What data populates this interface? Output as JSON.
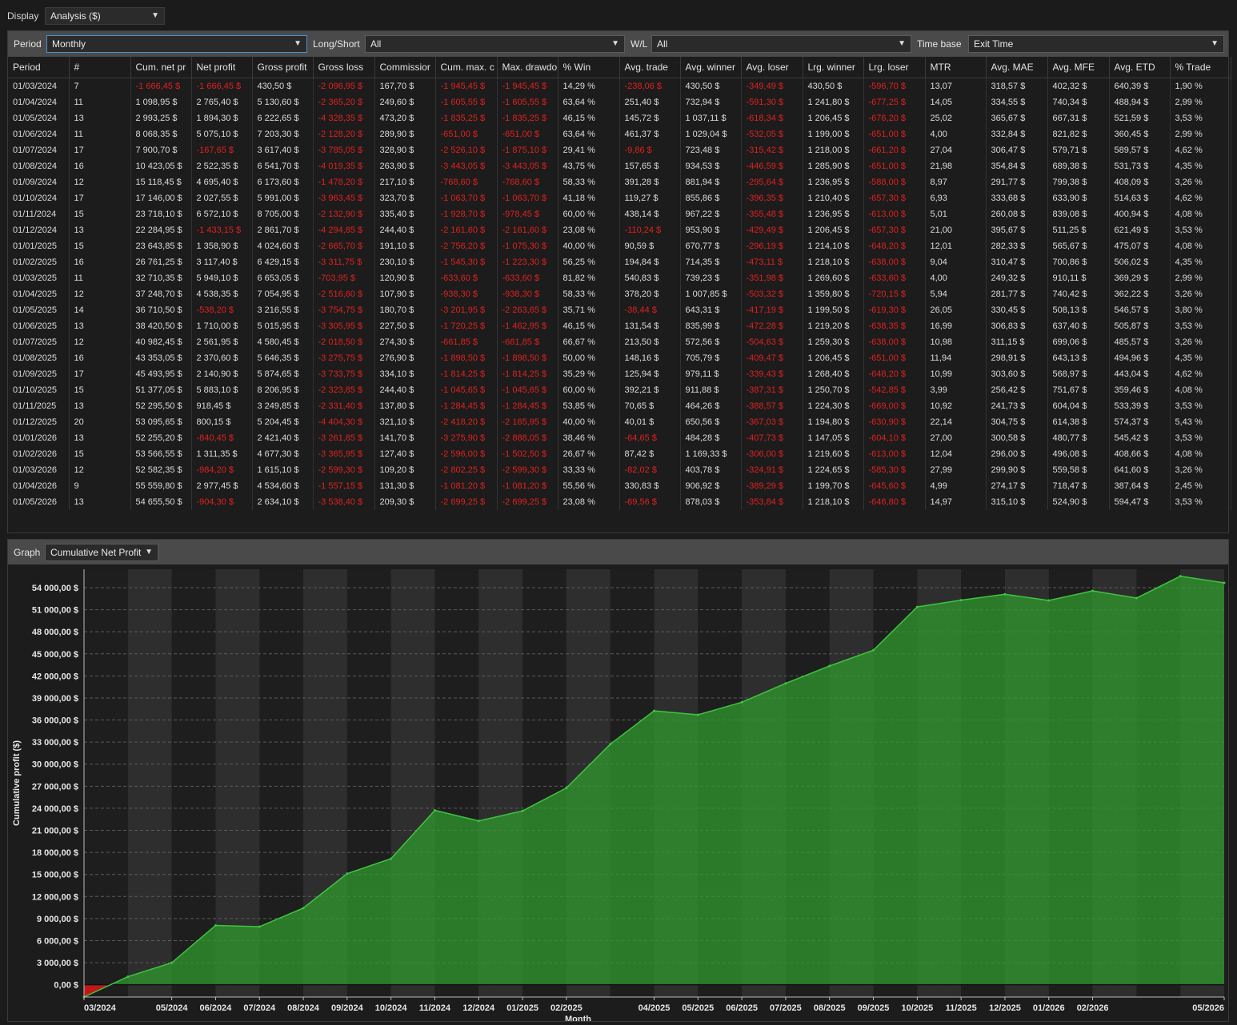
{
  "display": {
    "label": "Display",
    "value": "Analysis ($)"
  },
  "filters": {
    "period": {
      "label": "Period",
      "value": "Monthly"
    },
    "long_short": {
      "label": "Long/Short",
      "value": "All"
    },
    "wl": {
      "label": "W/L",
      "value": "All"
    },
    "time_base": {
      "label": "Time base",
      "value": "Exit Time"
    }
  },
  "table": {
    "columns": [
      "Period",
      "#",
      "Cum. net pr",
      "Net profit",
      "Gross profit",
      "Gross loss",
      "Commissior",
      "Cum. max. c",
      "Max. drawdo",
      "% Win",
      "Avg. trade",
      "Avg. winner",
      "Avg. loser",
      "Lrg. winner",
      "Lrg. loser",
      "MTR",
      "Avg. MAE",
      "Avg. MFE",
      "Avg. ETD",
      "% Trade"
    ],
    "rows": [
      [
        "01/03/2024",
        "7",
        "-1 666,45 $",
        "-1 666,45 $",
        "430,50 $",
        "-2 096,95 $",
        "167,70 $",
        "-1 945,45 $",
        "-1 945,45 $",
        "14,29 %",
        "-238,06 $",
        "430,50 $",
        "-349,49 $",
        "430,50 $",
        "-596,70 $",
        "13,07",
        "318,57 $",
        "402,32 $",
        "640,39 $",
        "1,90 %"
      ],
      [
        "01/04/2024",
        "11",
        "1 098,95 $",
        "2 765,40 $",
        "5 130,60 $",
        "-2 365,20 $",
        "249,60 $",
        "-1 605,55 $",
        "-1 605,55 $",
        "63,64 %",
        "251,40 $",
        "732,94 $",
        "-591,30 $",
        "1 241,80 $",
        "-677,25 $",
        "14,05",
        "334,55 $",
        "740,34 $",
        "488,94 $",
        "2,99 %"
      ],
      [
        "01/05/2024",
        "13",
        "2 993,25 $",
        "1 894,30 $",
        "6 222,65 $",
        "-4 328,35 $",
        "473,20 $",
        "-1 835,25 $",
        "-1 835,25 $",
        "46,15 %",
        "145,72 $",
        "1 037,11 $",
        "-618,34 $",
        "1 206,45 $",
        "-676,20 $",
        "25,02",
        "365,67 $",
        "667,31 $",
        "521,59 $",
        "3,53 %"
      ],
      [
        "01/06/2024",
        "11",
        "8 068,35 $",
        "5 075,10 $",
        "7 203,30 $",
        "-2 128,20 $",
        "289,90 $",
        "-651,00 $",
        "-651,00 $",
        "63,64 %",
        "461,37 $",
        "1 029,04 $",
        "-532,05 $",
        "1 199,00 $",
        "-651,00 $",
        "4,00",
        "332,84 $",
        "821,82 $",
        "360,45 $",
        "2,99 %"
      ],
      [
        "01/07/2024",
        "17",
        "7 900,70 $",
        "-167,65 $",
        "3 617,40 $",
        "-3 785,05 $",
        "328,90 $",
        "-2 526,10 $",
        "-1 875,10 $",
        "29,41 %",
        "-9,86 $",
        "723,48 $",
        "-315,42 $",
        "1 218,00 $",
        "-661,20 $",
        "27,04",
        "306,47 $",
        "579,71 $",
        "589,57 $",
        "4,62 %"
      ],
      [
        "01/08/2024",
        "16",
        "10 423,05 $",
        "2 522,35 $",
        "6 541,70 $",
        "-4 019,35 $",
        "263,90 $",
        "-3 443,05 $",
        "-3 443,05 $",
        "43,75 %",
        "157,65 $",
        "934,53 $",
        "-446,59 $",
        "1 285,90 $",
        "-651,00 $",
        "21,98",
        "354,84 $",
        "689,38 $",
        "531,73 $",
        "4,35 %"
      ],
      [
        "01/09/2024",
        "12",
        "15 118,45 $",
        "4 695,40 $",
        "6 173,60 $",
        "-1 478,20 $",
        "217,10 $",
        "-768,60 $",
        "-768,60 $",
        "58,33 %",
        "391,28 $",
        "881,94 $",
        "-295,64 $",
        "1 236,95 $",
        "-588,00 $",
        "8,97",
        "291,77 $",
        "799,38 $",
        "408,09 $",
        "3,26 %"
      ],
      [
        "01/10/2024",
        "17",
        "17 146,00 $",
        "2 027,55 $",
        "5 991,00 $",
        "-3 963,45 $",
        "323,70 $",
        "-1 063,70 $",
        "-1 063,70 $",
        "41,18 %",
        "119,27 $",
        "855,86 $",
        "-396,35 $",
        "1 210,40 $",
        "-657,30 $",
        "6,93",
        "333,68 $",
        "633,90 $",
        "514,63 $",
        "4,62 %"
      ],
      [
        "01/11/2024",
        "15",
        "23 718,10 $",
        "6 572,10 $",
        "8 705,00 $",
        "-2 132,90 $",
        "335,40 $",
        "-1 928,70 $",
        "-978,45 $",
        "60,00 %",
        "438,14 $",
        "967,22 $",
        "-355,48 $",
        "1 236,95 $",
        "-613,00 $",
        "5,01",
        "260,08 $",
        "839,08 $",
        "400,94 $",
        "4,08 %"
      ],
      [
        "01/12/2024",
        "13",
        "22 284,95 $",
        "-1 433,15 $",
        "2 861,70 $",
        "-4 294,85 $",
        "244,40 $",
        "-2 161,60 $",
        "-2 161,60 $",
        "23,08 %",
        "-110,24 $",
        "953,90 $",
        "-429,49 $",
        "1 206,45 $",
        "-657,30 $",
        "21,00",
        "395,67 $",
        "511,25 $",
        "621,49 $",
        "3,53 %"
      ],
      [
        "01/01/2025",
        "15",
        "23 643,85 $",
        "1 358,90 $",
        "4 024,60 $",
        "-2 665,70 $",
        "191,10 $",
        "-2 756,20 $",
        "-1 075,30 $",
        "40,00 %",
        "90,59 $",
        "670,77 $",
        "-296,19 $",
        "1 214,10 $",
        "-648,20 $",
        "12,01",
        "282,33 $",
        "565,67 $",
        "475,07 $",
        "4,08 %"
      ],
      [
        "01/02/2025",
        "16",
        "26 761,25 $",
        "3 117,40 $",
        "6 429,15 $",
        "-3 311,75 $",
        "230,10 $",
        "-1 545,30 $",
        "-1 223,30 $",
        "56,25 %",
        "194,84 $",
        "714,35 $",
        "-473,11 $",
        "1 218,10 $",
        "-638,00 $",
        "9,04",
        "310,47 $",
        "700,86 $",
        "506,02 $",
        "4,35 %"
      ],
      [
        "01/03/2025",
        "11",
        "32 710,35 $",
        "5 949,10 $",
        "6 653,05 $",
        "-703,95 $",
        "120,90 $",
        "-633,60 $",
        "-633,60 $",
        "81,82 %",
        "540,83 $",
        "739,23 $",
        "-351,98 $",
        "1 269,60 $",
        "-633,60 $",
        "4,00",
        "249,32 $",
        "910,11 $",
        "369,29 $",
        "2,99 %"
      ],
      [
        "01/04/2025",
        "12",
        "37 248,70 $",
        "4 538,35 $",
        "7 054,95 $",
        "-2 516,60 $",
        "107,90 $",
        "-938,30 $",
        "-938,30 $",
        "58,33 %",
        "378,20 $",
        "1 007,85 $",
        "-503,32 $",
        "1 359,80 $",
        "-720,15 $",
        "5,94",
        "281,77 $",
        "740,42 $",
        "362,22 $",
        "3,26 %"
      ],
      [
        "01/05/2025",
        "14",
        "36 710,50 $",
        "-538,20 $",
        "3 216,55 $",
        "-3 754,75 $",
        "180,70 $",
        "-3 201,95 $",
        "-2 263,65 $",
        "35,71 %",
        "-38,44 $",
        "643,31 $",
        "-417,19 $",
        "1 199,50 $",
        "-619,30 $",
        "26,05",
        "330,45 $",
        "508,13 $",
        "546,57 $",
        "3,80 %"
      ],
      [
        "01/06/2025",
        "13",
        "38 420,50 $",
        "1 710,00 $",
        "5 015,95 $",
        "-3 305,95 $",
        "227,50 $",
        "-1 720,25 $",
        "-1 462,95 $",
        "46,15 %",
        "131,54 $",
        "835,99 $",
        "-472,28 $",
        "1 219,20 $",
        "-638,35 $",
        "16,99",
        "306,83 $",
        "637,40 $",
        "505,87 $",
        "3,53 %"
      ],
      [
        "01/07/2025",
        "12",
        "40 982,45 $",
        "2 561,95 $",
        "4 580,45 $",
        "-2 018,50 $",
        "274,30 $",
        "-661,85 $",
        "-661,85 $",
        "66,67 %",
        "213,50 $",
        "572,56 $",
        "-504,63 $",
        "1 259,30 $",
        "-638,00 $",
        "10,98",
        "311,15 $",
        "699,06 $",
        "485,57 $",
        "3,26 %"
      ],
      [
        "01/08/2025",
        "16",
        "43 353,05 $",
        "2 370,60 $",
        "5 646,35 $",
        "-3 275,75 $",
        "276,90 $",
        "-1 898,50 $",
        "-1 898,50 $",
        "50,00 %",
        "148,16 $",
        "705,79 $",
        "-409,47 $",
        "1 206,45 $",
        "-651,00 $",
        "11,94",
        "298,91 $",
        "643,13 $",
        "494,96 $",
        "4,35 %"
      ],
      [
        "01/09/2025",
        "17",
        "45 493,95 $",
        "2 140,90 $",
        "5 874,65 $",
        "-3 733,75 $",
        "334,10 $",
        "-1 814,25 $",
        "-1 814,25 $",
        "35,29 %",
        "125,94 $",
        "979,11 $",
        "-339,43 $",
        "1 268,40 $",
        "-648,20 $",
        "10,99",
        "303,60 $",
        "568,97 $",
        "443,04 $",
        "4,62 %"
      ],
      [
        "01/10/2025",
        "15",
        "51 377,05 $",
        "5 883,10 $",
        "8 206,95 $",
        "-2 323,85 $",
        "244,40 $",
        "-1 045,65 $",
        "-1 045,65 $",
        "60,00 %",
        "392,21 $",
        "911,88 $",
        "-387,31 $",
        "1 250,70 $",
        "-542,85 $",
        "3,99",
        "256,42 $",
        "751,67 $",
        "359,46 $",
        "4,08 %"
      ],
      [
        "01/11/2025",
        "13",
        "52 295,50 $",
        "918,45 $",
        "3 249,85 $",
        "-2 331,40 $",
        "137,80 $",
        "-1 284,45 $",
        "-1 284,45 $",
        "53,85 %",
        "70,65 $",
        "464,26 $",
        "-388,57 $",
        "1 224,30 $",
        "-669,00 $",
        "10,92",
        "241,73 $",
        "604,04 $",
        "533,39 $",
        "3,53 %"
      ],
      [
        "01/12/2025",
        "20",
        "53 095,65 $",
        "800,15 $",
        "5 204,45 $",
        "-4 404,30 $",
        "321,10 $",
        "-2 418,20 $",
        "-2 165,95 $",
        "40,00 %",
        "40,01 $",
        "650,56 $",
        "-367,03 $",
        "1 194,80 $",
        "-630,90 $",
        "22,14",
        "304,75 $",
        "614,38 $",
        "574,37 $",
        "5,43 %"
      ],
      [
        "01/01/2026",
        "13",
        "52 255,20 $",
        "-840,45 $",
        "2 421,40 $",
        "-3 261,85 $",
        "141,70 $",
        "-3 275,90 $",
        "-2 888,05 $",
        "38,46 %",
        "-64,65 $",
        "484,28 $",
        "-407,73 $",
        "1 147,05 $",
        "-604,10 $",
        "27,00",
        "300,58 $",
        "480,77 $",
        "545,42 $",
        "3,53 %"
      ],
      [
        "01/02/2026",
        "15",
        "53 566,55 $",
        "1 311,35 $",
        "4 677,30 $",
        "-3 365,95 $",
        "127,40 $",
        "-2 596,00 $",
        "-1 502,50 $",
        "26,67 %",
        "87,42 $",
        "1 169,33 $",
        "-306,00 $",
        "1 219,60 $",
        "-613,00 $",
        "12,04",
        "296,00 $",
        "496,08 $",
        "408,66 $",
        "4,08 %"
      ],
      [
        "01/03/2026",
        "12",
        "52 582,35 $",
        "-984,20 $",
        "1 615,10 $",
        "-2 599,30 $",
        "109,20 $",
        "-2 802,25 $",
        "-2 599,30 $",
        "33,33 %",
        "-82,02 $",
        "403,78 $",
        "-324,91 $",
        "1 224,65 $",
        "-585,30 $",
        "27,99",
        "299,90 $",
        "559,58 $",
        "641,60 $",
        "3,26 %"
      ],
      [
        "01/04/2026",
        "9",
        "55 559,80 $",
        "2 977,45 $",
        "4 534,60 $",
        "-1 557,15 $",
        "131,30 $",
        "-1 081,20 $",
        "-1 081,20 $",
        "55,56 %",
        "330,83 $",
        "906,92 $",
        "-389,29 $",
        "1 199,70 $",
        "-645,60 $",
        "4,99",
        "274,17 $",
        "718,47 $",
        "387,64 $",
        "2,45 %"
      ],
      [
        "01/05/2026",
        "13",
        "54 655,50 $",
        "-904,30 $",
        "2 634,10 $",
        "-3 538,40 $",
        "209,30 $",
        "-2 699,25 $",
        "-2 699,25 $",
        "23,08 %",
        "-69,56 $",
        "878,03 $",
        "-353,84 $",
        "1 218,10 $",
        "-646,80 $",
        "14,97",
        "315,10 $",
        "524,90 $",
        "594,47 $",
        "3,53 %"
      ]
    ]
  },
  "graph": {
    "label": "Graph",
    "value": "Cumulative Net Profit"
  },
  "chart_data": {
    "type": "area",
    "xlabel": "Month",
    "ylabel": "Cumulative profit ($)",
    "ylim": [
      -1666.45,
      56500
    ],
    "yticks": [
      "0,00 $",
      "3 000,00 $",
      "6 000,00 $",
      "9 000,00 $",
      "12 000,00 $",
      "15 000,00 $",
      "18 000,00 $",
      "21 000,00 $",
      "24 000,00 $",
      "27 000,00 $",
      "30 000,00 $",
      "33 000,00 $",
      "36 000,00 $",
      "39 000,00 $",
      "42 000,00 $",
      "45 000,00 $",
      "48 000,00 $",
      "51 000,00 $",
      "54 000,00 $"
    ],
    "ytick_values": [
      0,
      3000,
      6000,
      9000,
      12000,
      15000,
      18000,
      21000,
      24000,
      27000,
      30000,
      33000,
      36000,
      39000,
      42000,
      45000,
      48000,
      51000,
      54000
    ],
    "xticks": [
      "03/2024",
      "05/2024",
      "06/2024",
      "07/2024",
      "08/2024",
      "09/2024",
      "10/2024",
      "11/2024",
      "12/2024",
      "01/2025",
      "02/2025",
      "04/2025",
      "05/2025",
      "06/2025",
      "07/2025",
      "08/2025",
      "09/2025",
      "10/2025",
      "11/2025",
      "12/2025",
      "01/2026",
      "02/2026",
      "05/2026"
    ],
    "xtick_index": [
      0,
      2,
      3,
      4,
      5,
      6,
      7,
      8,
      9,
      10,
      11,
      13,
      14,
      15,
      16,
      17,
      18,
      19,
      20,
      21,
      22,
      23,
      26
    ],
    "series": [
      {
        "values": [
          -1666.45,
          1098.95,
          2993.25,
          8068.35,
          7900.7,
          10423.05,
          15118.45,
          17146.0,
          23718.1,
          22284.95,
          23643.85,
          26761.25,
          32710.35,
          37248.7,
          36710.5,
          38420.5,
          40982.45,
          43353.05,
          45493.95,
          51377.05,
          52295.5,
          53095.65,
          52255.2,
          53566.55,
          52582.35,
          55559.8,
          54655.5
        ]
      }
    ],
    "colors": {
      "positive": "#2f9a2f",
      "negative": "#c01818",
      "line": "#3fc43f"
    },
    "grid": true
  }
}
